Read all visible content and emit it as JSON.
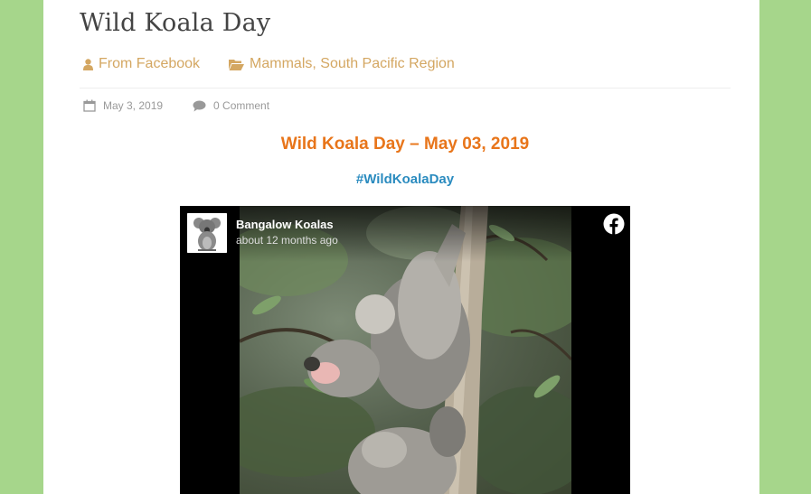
{
  "post": {
    "title": "Wild Koala Day",
    "author": "From Facebook",
    "categories": [
      "Mammals",
      "South Pacific Region"
    ],
    "category_separator": ",",
    "date": "May 3, 2019",
    "comments": "0 Comment"
  },
  "content": {
    "heading": "Wild Koala Day – May 03, 2019",
    "hashtag": "#WildKoalaDay"
  },
  "video": {
    "page_name": "Bangalow Koalas",
    "posted": "about 12 months ago"
  },
  "colors": {
    "background": "#a6d68b",
    "meta_link": "#d4a762",
    "heading": "#e8751a",
    "hashtag": "#2a8bbf"
  },
  "icons": [
    "user-icon",
    "folder-open-icon",
    "calendar-icon",
    "comment-icon",
    "facebook-icon"
  ]
}
